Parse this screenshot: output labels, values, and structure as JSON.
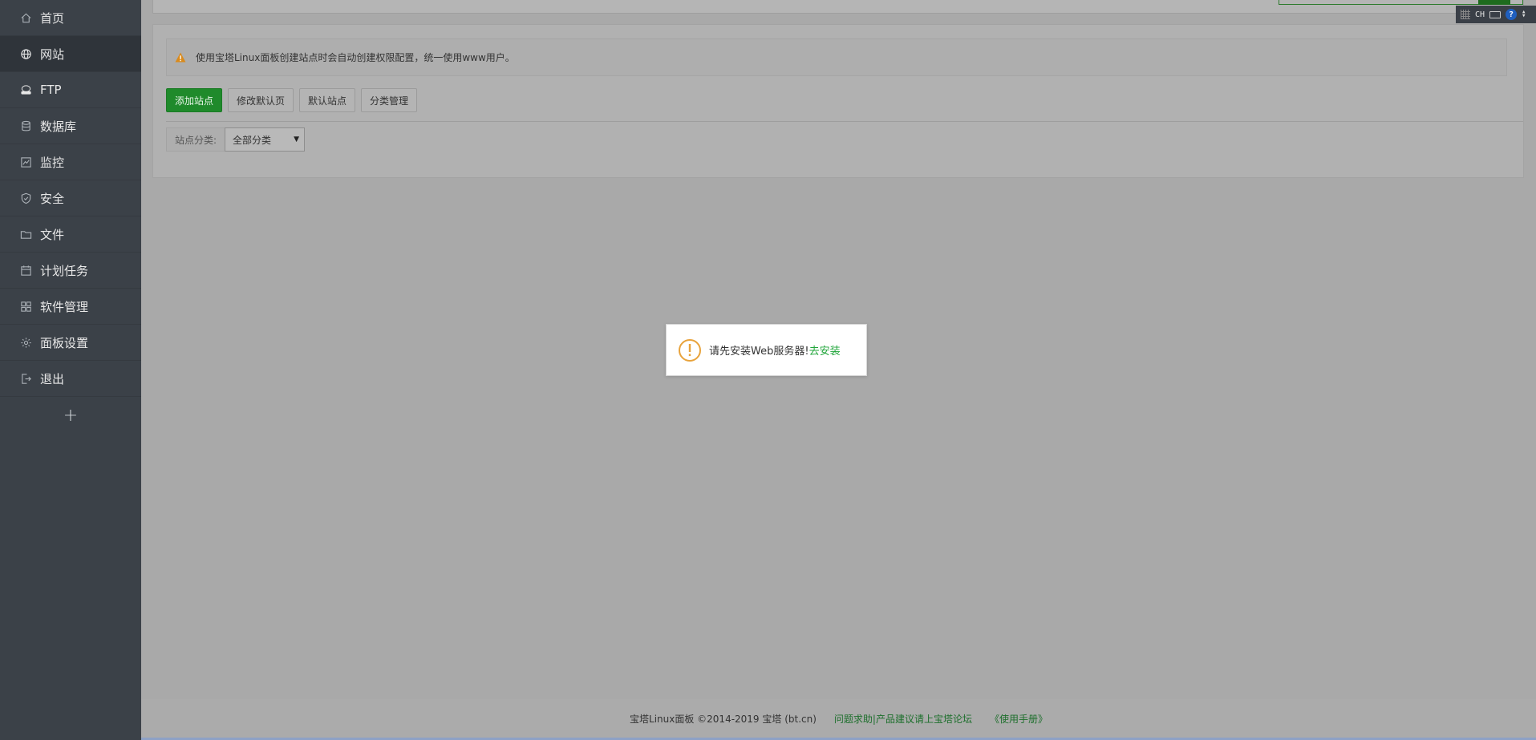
{
  "sidebar": {
    "items": [
      {
        "label": "首页",
        "icon": "home-icon"
      },
      {
        "label": "网站",
        "icon": "globe-icon",
        "active": true
      },
      {
        "label": "FTP",
        "icon": "ftp-icon"
      },
      {
        "label": "数据库",
        "icon": "database-icon"
      },
      {
        "label": "监控",
        "icon": "monitor-icon"
      },
      {
        "label": "安全",
        "icon": "shield-icon"
      },
      {
        "label": "文件",
        "icon": "folder-icon"
      },
      {
        "label": "计划任务",
        "icon": "calendar-icon"
      },
      {
        "label": "软件管理",
        "icon": "grid-icon"
      },
      {
        "label": "面板设置",
        "icon": "gear-icon"
      },
      {
        "label": "退出",
        "icon": "logout-icon"
      }
    ],
    "add_label": "+"
  },
  "notice": {
    "text": "使用宝塔Linux面板创建站点时会自动创建权限配置，统一使用www用户。"
  },
  "toolbar": {
    "add_site": "添加站点",
    "edit_default_page": "修改默认页",
    "default_site": "默认站点",
    "category_manage": "分类管理"
  },
  "filter": {
    "label": "站点分类:",
    "selected": "全部分类"
  },
  "modal": {
    "message": "请先安装Web服务器!",
    "link": "去安装"
  },
  "footer": {
    "copyright": "宝塔Linux面板 ©2014-2019 宝塔 (bt.cn)",
    "forum_link": "问题求助|产品建议请上宝塔论坛",
    "manual_link": "《使用手册》"
  },
  "tray": {
    "lang": "CH",
    "help": "?"
  },
  "colors": {
    "sidebar_bg": "#3b4148",
    "primary_green": "#1f8a2b",
    "link_green": "#20a53a",
    "warning_orange": "#e8a33c"
  }
}
